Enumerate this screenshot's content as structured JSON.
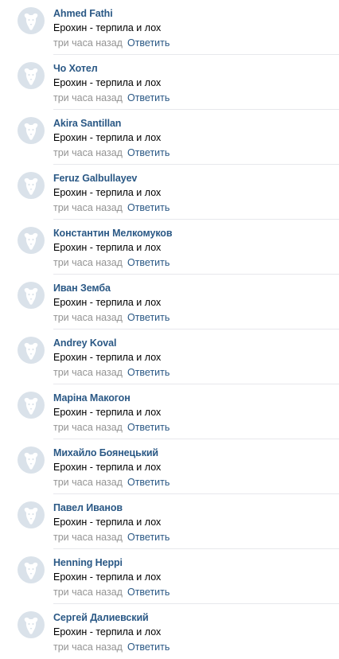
{
  "colors": {
    "author": "#2a5885",
    "time": "#939393",
    "avatar_bg": "#dae2ea",
    "divider": "#e7e8ec"
  },
  "comments": [
    {
      "author": "Ahmed Fathi",
      "text": "Ерохин - терпила и лох",
      "time": "три часа назад",
      "reply": "Ответить",
      "avatar_icon": "dog-placeholder-icon"
    },
    {
      "author": "Чо Хотел",
      "text": "Ерохин - терпила и лох",
      "time": "три часа назад",
      "reply": "Ответить",
      "avatar_icon": "dog-placeholder-icon"
    },
    {
      "author": "Akira Santillan",
      "text": "Ерохин - терпила и лох",
      "time": "три часа назад",
      "reply": "Ответить",
      "avatar_icon": "dog-placeholder-icon"
    },
    {
      "author": "Feruz Galbullayev",
      "text": "Ерохин - терпила и лох",
      "time": "три часа назад",
      "reply": "Ответить",
      "avatar_icon": "dog-placeholder-icon"
    },
    {
      "author": "Константин Мелкомуков",
      "text": "Ерохин - терпила и лох",
      "time": "три часа назад",
      "reply": "Ответить",
      "avatar_icon": "dog-placeholder-icon"
    },
    {
      "author": "Иван Земба",
      "text": "Ерохин - терпила и лох",
      "time": "три часа назад",
      "reply": "Ответить",
      "avatar_icon": "dog-placeholder-icon"
    },
    {
      "author": "Andrey Koval",
      "text": "Ерохин - терпила и лох",
      "time": "три часа назад",
      "reply": "Ответить",
      "avatar_icon": "dog-placeholder-icon"
    },
    {
      "author": "Маріна Макогон",
      "text": "Ерохин - терпила и лох",
      "time": "три часа назад",
      "reply": "Ответить",
      "avatar_icon": "dog-placeholder-icon"
    },
    {
      "author": "Михайло Боянецький",
      "text": "Ерохин - терпила и лох",
      "time": "три часа назад",
      "reply": "Ответить",
      "avatar_icon": "dog-placeholder-icon"
    },
    {
      "author": "Павел Иванов",
      "text": "Ерохин - терпила и лох",
      "time": "три часа назад",
      "reply": "Ответить",
      "avatar_icon": "dog-placeholder-icon"
    },
    {
      "author": "Henning Heppi",
      "text": "Ерохин - терпила и лох",
      "time": "три часа назад",
      "reply": "Ответить",
      "avatar_icon": "dog-placeholder-icon"
    },
    {
      "author": "Сергей Далиевский",
      "text": "Ерохин - терпила и лох",
      "time": "три часа назад",
      "reply": "Ответить",
      "avatar_icon": "dog-placeholder-icon"
    }
  ]
}
